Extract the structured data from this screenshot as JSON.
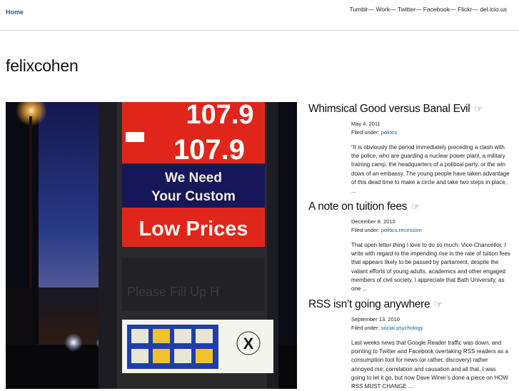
{
  "nav": {
    "home": "Home",
    "links": [
      "Tumblr",
      "Work",
      "Twitter",
      "Facebook",
      "Flickr",
      "del.icio.us"
    ],
    "separator": "— "
  },
  "site": {
    "title": "felixcohen"
  },
  "photo": {
    "sign_price_top": "107.9",
    "sign_price_bottom": "107.9",
    "sign_line1": "We Need",
    "sign_line2": "Your Custom",
    "sign_low_prices": "Low Prices",
    "sign_faded": "Please Fill Up H"
  },
  "posts": [
    {
      "title": "Whimsical Good versus Banal Evil",
      "date": "May 4. 2011",
      "filed_label": "Filed under: ",
      "category": "politics",
      "excerpt": "“It is obviously the period immediately preceding a clash with the police, who are guarding a nuclear power plant, a military training camp, the headquarters of a political party, or the win dows of an embassy. The young people have taken advantage of this dead time to make a circle and take two steps in place, ..."
    },
    {
      "title": "A note on tuition fees",
      "date": "December 8. 2010",
      "filed_label": "Filed under: ",
      "category": "politics.recession",
      "excerpt": "That open letter thing I love to do so much: Vice-Chancellor, I write with regard to the impending rise in the rate of tuition fees that appears likely to be passed by parliament, despite the valiant efforts of young adults, academics and other engaged members of civil society. I appreciate that Bath University, as one ..."
    },
    {
      "title": "RSS isn’t going anywhere",
      "date": "September 13. 2010",
      "filed_label": "Filed under: ",
      "category": "social psychology",
      "excerpt": "Last weeks news that Google Reader traffic was down, and pointing to Twitter and Facebook overtaking RSS readers as a consumption tool for news (or rather, discovery) rather annoyed me; correlation and causation and all that. I was going to let it go, but now Dave Winer’s done a piece on HOW RSS MUST CHANGE ..."
    }
  ],
  "icons": {
    "post_link": "☞"
  },
  "colors": {
    "link": "#1a5e9a",
    "sign_red": "#e0261b",
    "sign_navy": "#16165a"
  }
}
